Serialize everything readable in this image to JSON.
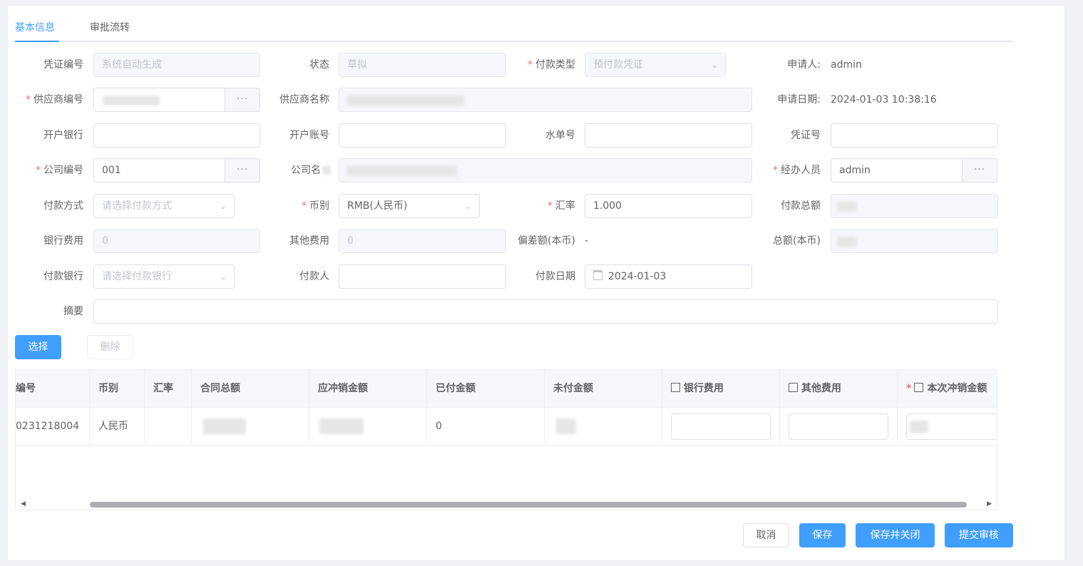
{
  "tabs": [
    {
      "label": "基本信息",
      "active": true
    },
    {
      "label": "审批流转",
      "active": false
    }
  ],
  "form": {
    "voucher_no": {
      "label": "凭证编号",
      "placeholder": "系统自动生成"
    },
    "status": {
      "label": "状态",
      "value": "草拟"
    },
    "pay_type": {
      "label": "付款类型",
      "value": "预付款凭证"
    },
    "applicant": {
      "label": "申请人:",
      "value": "admin"
    },
    "supplier_code": {
      "label": "供应商编号"
    },
    "supplier_name": {
      "label": "供应商名称"
    },
    "apply_date": {
      "label": "申请日期:",
      "value": "2024-01-03 10:38:16"
    },
    "bank": {
      "label": "开户银行"
    },
    "account": {
      "label": "开户账号"
    },
    "serial_no": {
      "label": "水单号"
    },
    "voucher_num": {
      "label": "凭证号"
    },
    "company_code": {
      "label": "公司编号",
      "value": "001"
    },
    "company_name": {
      "label": "公司名"
    },
    "handler": {
      "label": "经办人员",
      "value": "admin"
    },
    "pay_method": {
      "label": "付款方式",
      "placeholder": "请选择付款方式"
    },
    "currency": {
      "label": "币别",
      "value": "RMB(人民币)"
    },
    "rate": {
      "label": "汇率",
      "value": "1.000"
    },
    "pay_total": {
      "label": "付款总额"
    },
    "bank_fee": {
      "label": "银行费用",
      "value": "0"
    },
    "other_fee": {
      "label": "其他费用",
      "value": "0"
    },
    "deviation": {
      "label": "偏差额(本币)",
      "value": "-"
    },
    "total_local": {
      "label": "总额(本币)"
    },
    "pay_bank": {
      "label": "付款银行",
      "placeholder": "请选择付款银行"
    },
    "payer": {
      "label": "付款人"
    },
    "pay_date": {
      "label": "付款日期",
      "value": "2024-01-03"
    },
    "summary": {
      "label": "摘要"
    }
  },
  "actions": {
    "select": "选择",
    "delete": "删除"
  },
  "table": {
    "headers": [
      "编号",
      "币别",
      "汇率",
      "合同总额",
      "应冲销金额",
      "已付金额",
      "未付金额",
      "银行费用",
      "其他费用",
      "本次冲销金额"
    ],
    "row": {
      "no": "0231218004",
      "currency": "人民币",
      "paid": "0"
    }
  },
  "footer": {
    "cancel": "取消",
    "save": "保存",
    "save_close": "保存并关闭",
    "submit": "提交审核"
  },
  "colors": {
    "primary": "#409eff",
    "required": "#f56c6c"
  }
}
